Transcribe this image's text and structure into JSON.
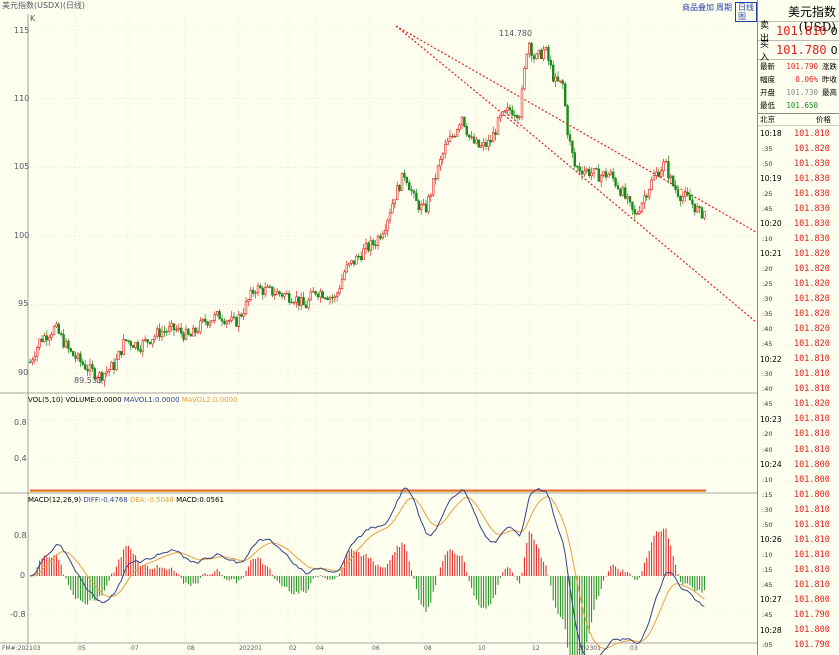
{
  "header": {
    "k_label": "K",
    "title_label": "美元指数(USDX)(日线)",
    "links": [
      "商品叠加",
      "周期",
      "日线图"
    ]
  },
  "main_axis": {
    "ticks": [
      "115",
      "110",
      "105",
      "100",
      "95",
      "90"
    ]
  },
  "annotations": {
    "high": "114.780",
    "low": "89.533"
  },
  "volume_panel": {
    "indicator": "VOL(5,10)",
    "volume": "VOLUME:0.0000",
    "mavol1": "MAVOL1:0.0000",
    "mavol2": "MAVOL2:0.0000",
    "ticks": [
      "0.8",
      "0.4"
    ]
  },
  "macd_panel": {
    "indicator": "MACD(12,26,9)",
    "diff": "DIFF:-0.4768",
    "dea": "DEA:-0.5048",
    "macd": "MACD:0.0561",
    "ticks": [
      "0.8",
      "0",
      "-0.8"
    ]
  },
  "x_axis": {
    "labels": [
      "FM#:202103",
      "05",
      "07",
      "08",
      "202201",
      "02",
      "04",
      "06",
      "08",
      "10",
      "12",
      "202301",
      "03"
    ]
  },
  "colors": {
    "up": "#e02020",
    "down": "#1a8a1a",
    "diff": "#334488",
    "dea": "#e8a040",
    "channel": "#e02020",
    "background": "#fffff0"
  },
  "side_panel": {
    "title": "美元指数(USD)",
    "sell_label": "卖出",
    "sell_price": "101.810",
    "sell_vol": "0",
    "buy_label": "买入",
    "buy_price": "101.780",
    "buy_vol": "0",
    "stats": [
      {
        "label": "最新",
        "value": "101.790",
        "right": "涨跌",
        "color": "red"
      },
      {
        "label": "幅度",
        "value": "0.06%",
        "right": "昨收",
        "color": "red"
      },
      {
        "label": "开盘",
        "value": "101.730",
        "right": "最高",
        "color": "gray"
      },
      {
        "label": "最低",
        "value": "101.650",
        "right": "",
        "color": "green"
      }
    ],
    "tick_header": {
      "time": "北京",
      "price": "价格"
    },
    "ticks": [
      {
        "time": "10:18",
        "price": "101.810"
      },
      {
        "time": ":35",
        "price": "101.820"
      },
      {
        "time": ":50",
        "price": "101.830"
      },
      {
        "time": "10:19",
        "price": "101.830"
      },
      {
        "time": ":25",
        "price": "101.830"
      },
      {
        "time": ":45",
        "price": "101.830"
      },
      {
        "time": "10:20",
        "price": "101.830"
      },
      {
        "time": ":10",
        "price": "101.830"
      },
      {
        "time": "10:21",
        "price": "101.820"
      },
      {
        "time": ":20",
        "price": "101.820"
      },
      {
        "time": ":25",
        "price": "101.820"
      },
      {
        "time": ":30",
        "price": "101.820"
      },
      {
        "time": ":35",
        "price": "101.820"
      },
      {
        "time": ":40",
        "price": "101.820"
      },
      {
        "time": ":45",
        "price": "101.820"
      },
      {
        "time": "10:22",
        "price": "101.810"
      },
      {
        "time": ":30",
        "price": "101.810"
      },
      {
        "time": ":40",
        "price": "101.810"
      },
      {
        "time": ":45",
        "price": "101.820"
      },
      {
        "time": "10:23",
        "price": "101.810"
      },
      {
        "time": ":20",
        "price": "101.810"
      },
      {
        "time": ":40",
        "price": "101.810"
      },
      {
        "time": "10:24",
        "price": "101.800"
      },
      {
        "time": ":10",
        "price": "101.800"
      },
      {
        "time": ":15",
        "price": "101.800"
      },
      {
        "time": ":30",
        "price": "101.810"
      },
      {
        "time": ":50",
        "price": "101.810"
      },
      {
        "time": "10:26",
        "price": "101.810"
      },
      {
        "time": ":10",
        "price": "101.810"
      },
      {
        "time": ":15",
        "price": "101.810"
      },
      {
        "time": ":45",
        "price": "101.810"
      },
      {
        "time": "10:27",
        "price": "101.800"
      },
      {
        "time": ":45",
        "price": "101.790"
      },
      {
        "time": "10:28",
        "price": "101.800"
      },
      {
        "time": ":05",
        "price": "101.790"
      }
    ]
  }
}
